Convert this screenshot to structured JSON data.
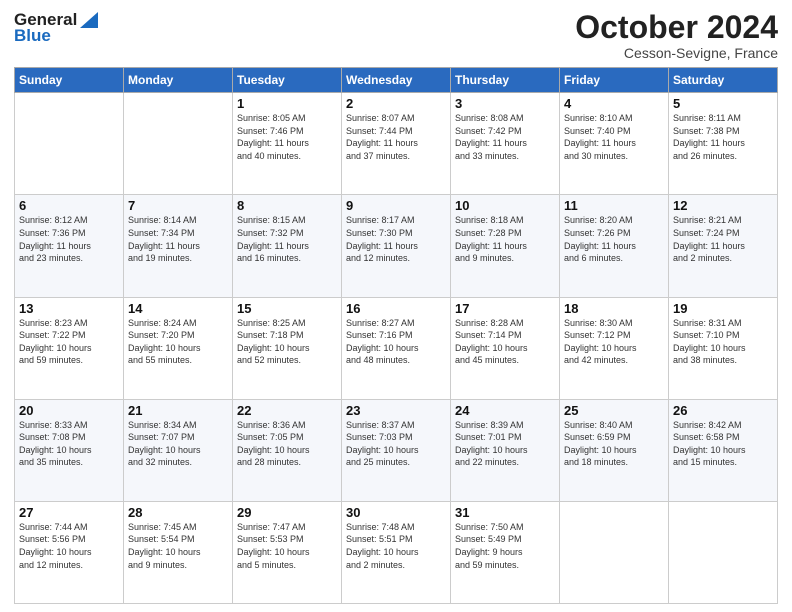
{
  "header": {
    "logo_general": "General",
    "logo_blue": "Blue",
    "month": "October 2024",
    "location": "Cesson-Sevigne, France"
  },
  "weekdays": [
    "Sunday",
    "Monday",
    "Tuesday",
    "Wednesday",
    "Thursday",
    "Friday",
    "Saturday"
  ],
  "weeks": [
    [
      {
        "day": "",
        "info": ""
      },
      {
        "day": "",
        "info": ""
      },
      {
        "day": "1",
        "info": "Sunrise: 8:05 AM\nSunset: 7:46 PM\nDaylight: 11 hours\nand 40 minutes."
      },
      {
        "day": "2",
        "info": "Sunrise: 8:07 AM\nSunset: 7:44 PM\nDaylight: 11 hours\nand 37 minutes."
      },
      {
        "day": "3",
        "info": "Sunrise: 8:08 AM\nSunset: 7:42 PM\nDaylight: 11 hours\nand 33 minutes."
      },
      {
        "day": "4",
        "info": "Sunrise: 8:10 AM\nSunset: 7:40 PM\nDaylight: 11 hours\nand 30 minutes."
      },
      {
        "day": "5",
        "info": "Sunrise: 8:11 AM\nSunset: 7:38 PM\nDaylight: 11 hours\nand 26 minutes."
      }
    ],
    [
      {
        "day": "6",
        "info": "Sunrise: 8:12 AM\nSunset: 7:36 PM\nDaylight: 11 hours\nand 23 minutes."
      },
      {
        "day": "7",
        "info": "Sunrise: 8:14 AM\nSunset: 7:34 PM\nDaylight: 11 hours\nand 19 minutes."
      },
      {
        "day": "8",
        "info": "Sunrise: 8:15 AM\nSunset: 7:32 PM\nDaylight: 11 hours\nand 16 minutes."
      },
      {
        "day": "9",
        "info": "Sunrise: 8:17 AM\nSunset: 7:30 PM\nDaylight: 11 hours\nand 12 minutes."
      },
      {
        "day": "10",
        "info": "Sunrise: 8:18 AM\nSunset: 7:28 PM\nDaylight: 11 hours\nand 9 minutes."
      },
      {
        "day": "11",
        "info": "Sunrise: 8:20 AM\nSunset: 7:26 PM\nDaylight: 11 hours\nand 6 minutes."
      },
      {
        "day": "12",
        "info": "Sunrise: 8:21 AM\nSunset: 7:24 PM\nDaylight: 11 hours\nand 2 minutes."
      }
    ],
    [
      {
        "day": "13",
        "info": "Sunrise: 8:23 AM\nSunset: 7:22 PM\nDaylight: 10 hours\nand 59 minutes."
      },
      {
        "day": "14",
        "info": "Sunrise: 8:24 AM\nSunset: 7:20 PM\nDaylight: 10 hours\nand 55 minutes."
      },
      {
        "day": "15",
        "info": "Sunrise: 8:25 AM\nSunset: 7:18 PM\nDaylight: 10 hours\nand 52 minutes."
      },
      {
        "day": "16",
        "info": "Sunrise: 8:27 AM\nSunset: 7:16 PM\nDaylight: 10 hours\nand 48 minutes."
      },
      {
        "day": "17",
        "info": "Sunrise: 8:28 AM\nSunset: 7:14 PM\nDaylight: 10 hours\nand 45 minutes."
      },
      {
        "day": "18",
        "info": "Sunrise: 8:30 AM\nSunset: 7:12 PM\nDaylight: 10 hours\nand 42 minutes."
      },
      {
        "day": "19",
        "info": "Sunrise: 8:31 AM\nSunset: 7:10 PM\nDaylight: 10 hours\nand 38 minutes."
      }
    ],
    [
      {
        "day": "20",
        "info": "Sunrise: 8:33 AM\nSunset: 7:08 PM\nDaylight: 10 hours\nand 35 minutes."
      },
      {
        "day": "21",
        "info": "Sunrise: 8:34 AM\nSunset: 7:07 PM\nDaylight: 10 hours\nand 32 minutes."
      },
      {
        "day": "22",
        "info": "Sunrise: 8:36 AM\nSunset: 7:05 PM\nDaylight: 10 hours\nand 28 minutes."
      },
      {
        "day": "23",
        "info": "Sunrise: 8:37 AM\nSunset: 7:03 PM\nDaylight: 10 hours\nand 25 minutes."
      },
      {
        "day": "24",
        "info": "Sunrise: 8:39 AM\nSunset: 7:01 PM\nDaylight: 10 hours\nand 22 minutes."
      },
      {
        "day": "25",
        "info": "Sunrise: 8:40 AM\nSunset: 6:59 PM\nDaylight: 10 hours\nand 18 minutes."
      },
      {
        "day": "26",
        "info": "Sunrise: 8:42 AM\nSunset: 6:58 PM\nDaylight: 10 hours\nand 15 minutes."
      }
    ],
    [
      {
        "day": "27",
        "info": "Sunrise: 7:44 AM\nSunset: 5:56 PM\nDaylight: 10 hours\nand 12 minutes."
      },
      {
        "day": "28",
        "info": "Sunrise: 7:45 AM\nSunset: 5:54 PM\nDaylight: 10 hours\nand 9 minutes."
      },
      {
        "day": "29",
        "info": "Sunrise: 7:47 AM\nSunset: 5:53 PM\nDaylight: 10 hours\nand 5 minutes."
      },
      {
        "day": "30",
        "info": "Sunrise: 7:48 AM\nSunset: 5:51 PM\nDaylight: 10 hours\nand 2 minutes."
      },
      {
        "day": "31",
        "info": "Sunrise: 7:50 AM\nSunset: 5:49 PM\nDaylight: 9 hours\nand 59 minutes."
      },
      {
        "day": "",
        "info": ""
      },
      {
        "day": "",
        "info": ""
      }
    ]
  ]
}
